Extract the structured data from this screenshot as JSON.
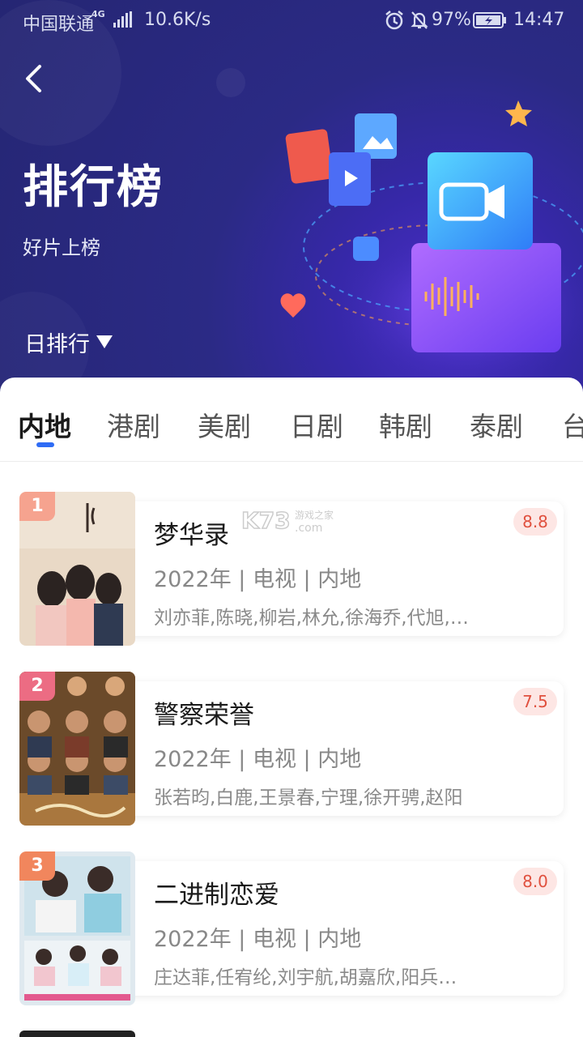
{
  "status_bar": {
    "carrier": "中国联通",
    "network": "4G",
    "speed": "10.6K/s",
    "battery": "97%",
    "time": "14:47"
  },
  "header": {
    "title": "排行榜",
    "subtitle": "好片上榜",
    "period": "日排行"
  },
  "tabs": [
    {
      "label": "内地",
      "active": true
    },
    {
      "label": "港剧"
    },
    {
      "label": "美剧"
    },
    {
      "label": "日剧"
    },
    {
      "label": "韩剧"
    },
    {
      "label": "泰剧"
    },
    {
      "label": "台"
    }
  ],
  "items": [
    {
      "rank": "1",
      "title": "梦华录",
      "meta": "2022年 | 电视 | 内地",
      "cast": "刘亦菲,陈晓,柳岩,林允,徐海乔,代旭,…",
      "score": "8.8",
      "badge_color": "#f6a38f"
    },
    {
      "rank": "2",
      "title": "警察荣誉",
      "meta": "2022年 | 电视 | 内地",
      "cast": "张若昀,白鹿,王景春,宁理,徐开骋,赵阳",
      "score": "7.5",
      "badge_color": "#ec6c83"
    },
    {
      "rank": "3",
      "title": "二进制恋爱",
      "meta": "2022年 | 电视 | 内地",
      "cast": "庄达菲,任宥纶,刘宇航,胡嘉欣,阳兵…",
      "score": "8.0",
      "badge_color": "#f1865d"
    }
  ],
  "watermark": "K73 游戏之家 .com"
}
